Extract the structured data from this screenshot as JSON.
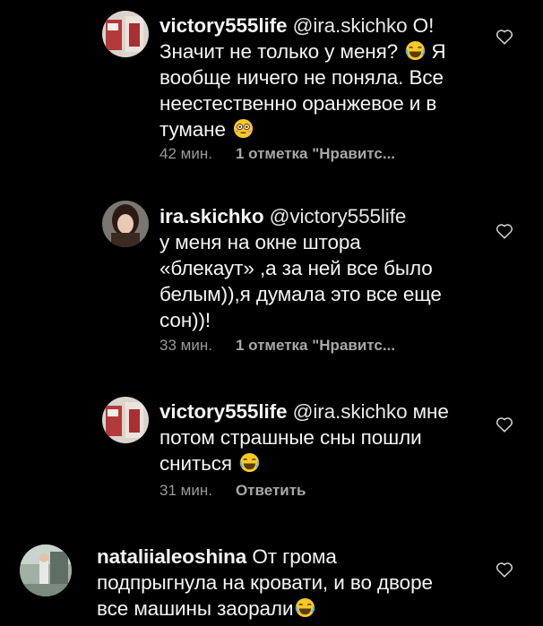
{
  "comments": [
    {
      "username": "victory555life",
      "lines": [
        {
          "mention": "@ira.skichko",
          "text": " О!"
        },
        {
          "text": "Значит не только у меня? ",
          "emoji": "laughing-emoji",
          "after": " Я"
        },
        {
          "text": "вообще ничего не поняла. Все"
        },
        {
          "text": "неестественно оранжевое и в"
        },
        {
          "text": "тумане ",
          "emoji": "flushed-emoji"
        }
      ],
      "time": "42 мин.",
      "likes": "1 отметка \"Нравитс...",
      "reply": ""
    },
    {
      "username": "ira.skichko",
      "lines": [
        {
          "mention": "@victory555life",
          "text": ""
        },
        {
          "text": "у меня на окне штора"
        },
        {
          "text": "«блекаут» ,а за ней все было"
        },
        {
          "text": "белым)),я думала это все еще"
        },
        {
          "text": "сон))!"
        }
      ],
      "time": "33 мин.",
      "likes": "1 отметка \"Нравитс...",
      "reply": ""
    },
    {
      "username": "victory555life",
      "lines": [
        {
          "mention": "@ira.skichko",
          "text": " мне"
        },
        {
          "text": "потом страшные сны пошли"
        },
        {
          "text": "сниться ",
          "emoji": "laughing-emoji"
        }
      ],
      "time": "31 мин.",
      "likes": "",
      "reply": "Ответить"
    },
    {
      "username": "nataliialeoshina",
      "lines": [
        {
          "text": " От грома"
        },
        {
          "text": "подпрыгнула на кровати, и во дворе"
        },
        {
          "text": "все машины заорали",
          "emoji": "laughing-emoji"
        }
      ],
      "time": "",
      "likes": "",
      "reply": ""
    }
  ]
}
